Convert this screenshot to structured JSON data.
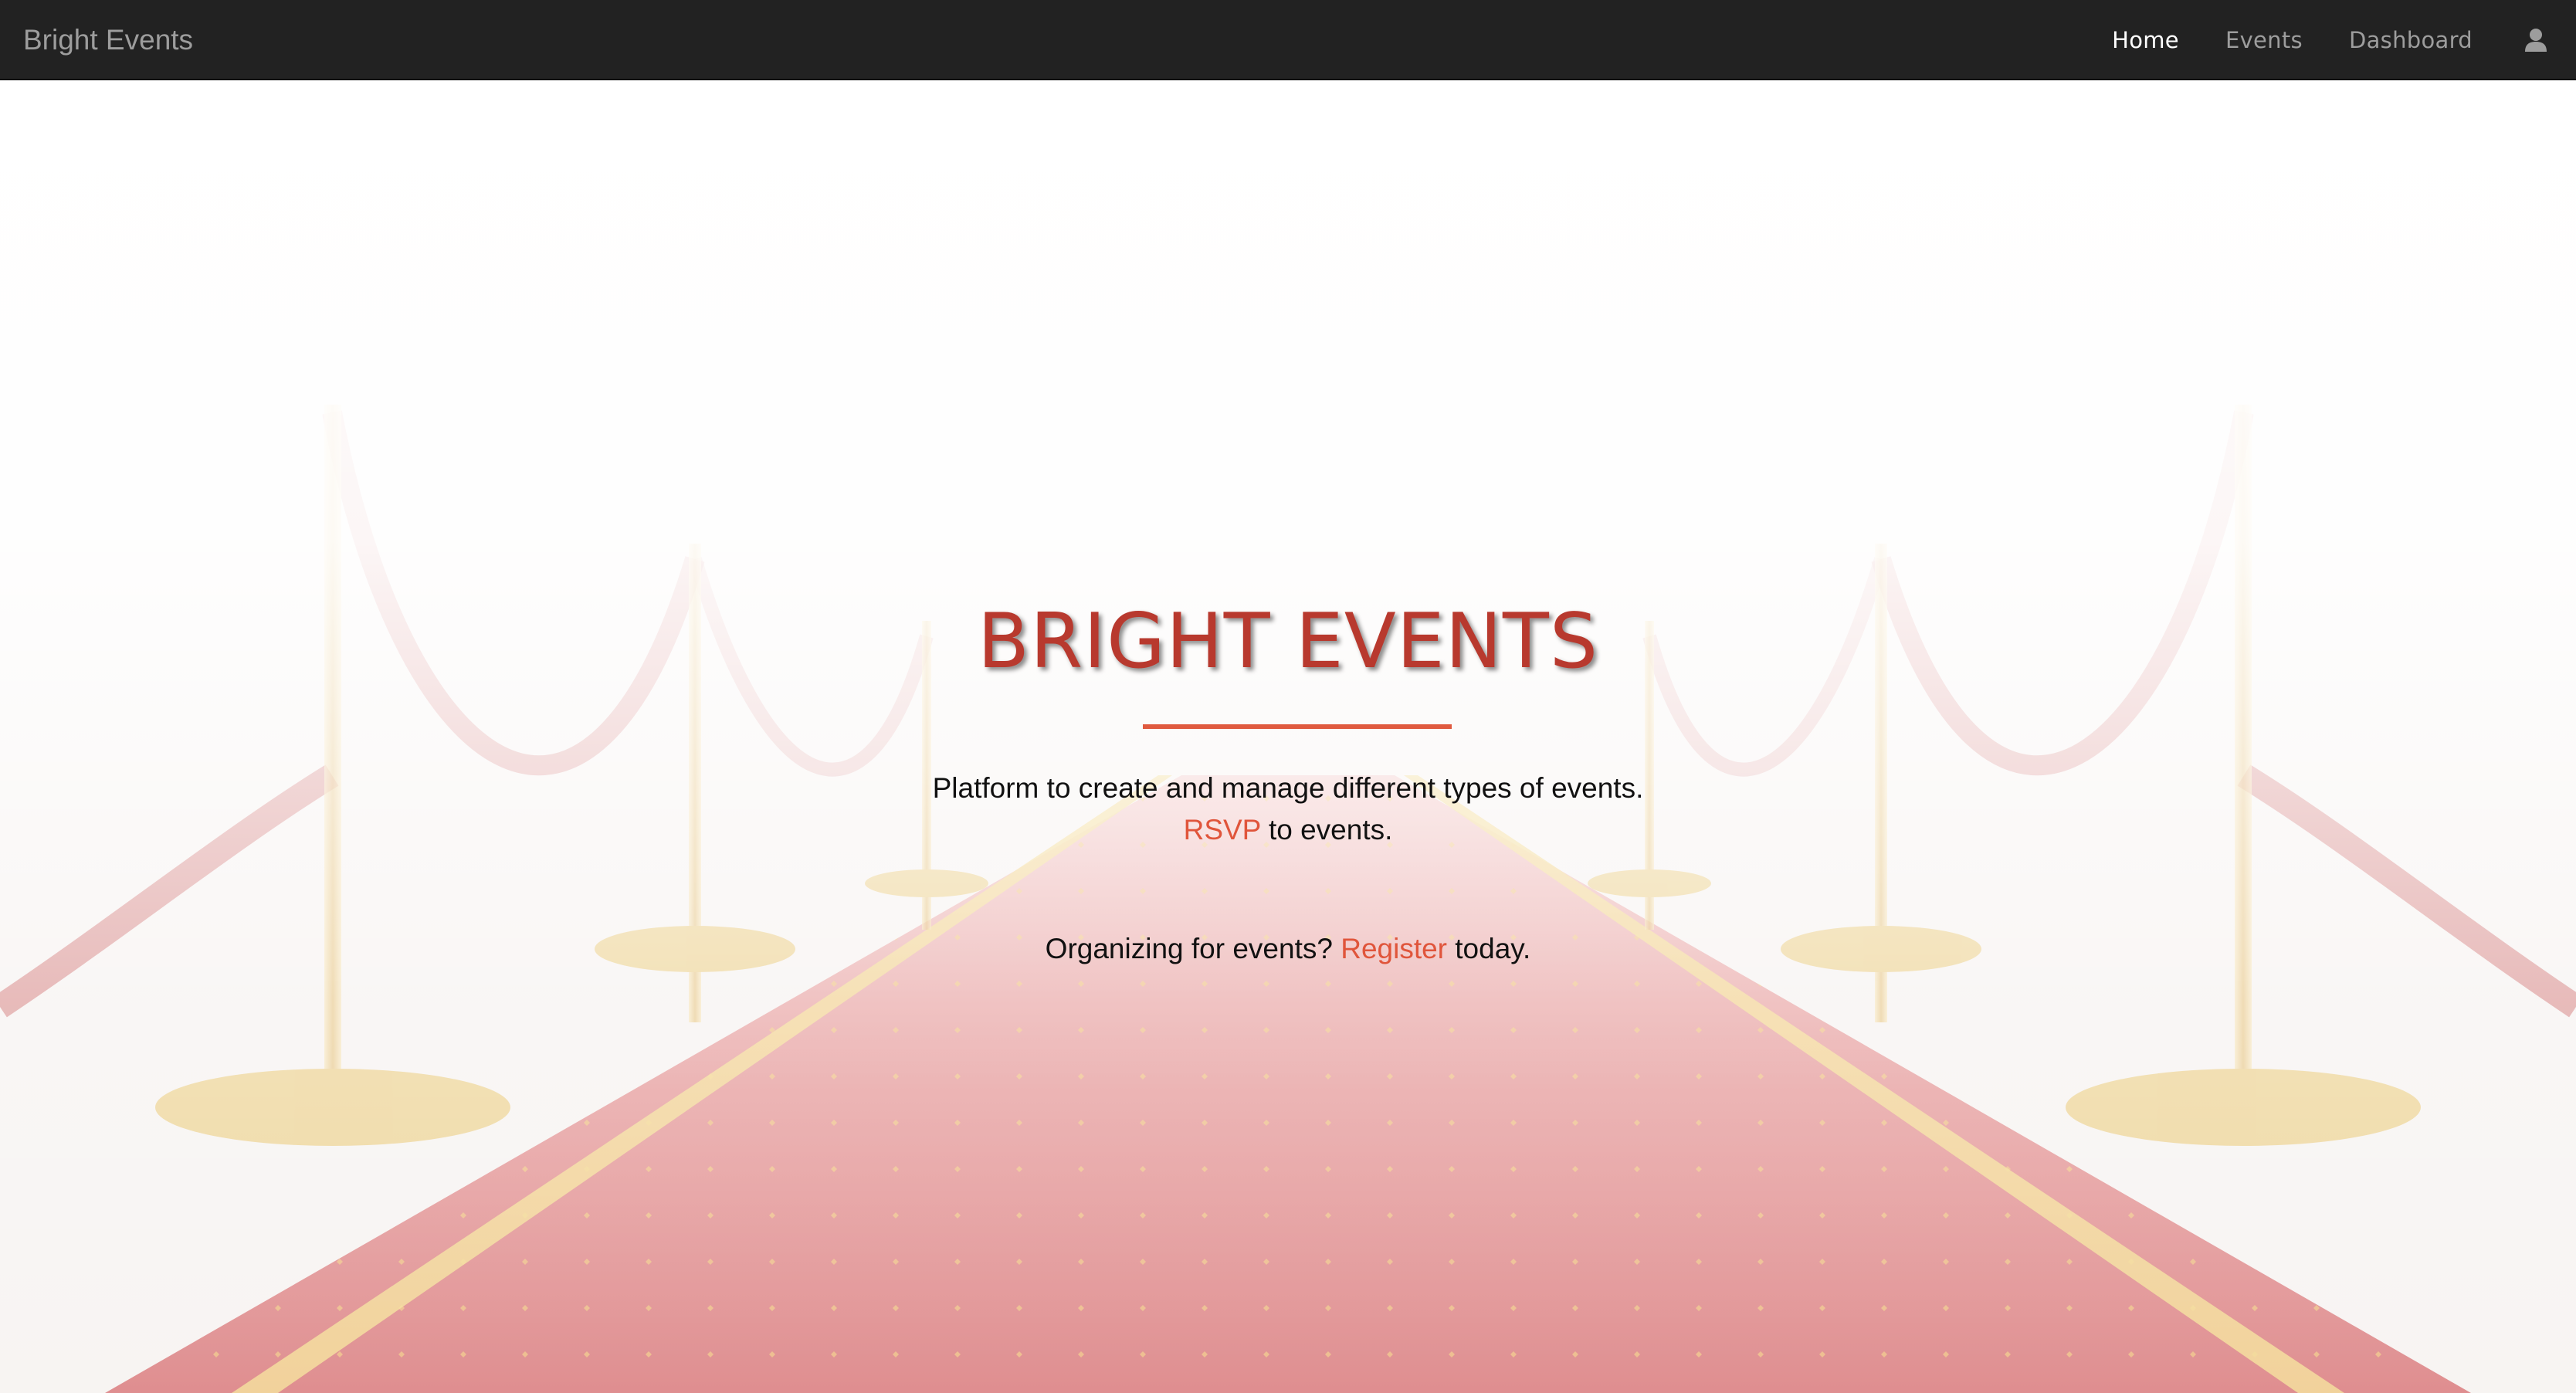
{
  "navbar": {
    "brand": "Bright Events",
    "links": [
      {
        "label": "Home",
        "active": true
      },
      {
        "label": "Events",
        "active": false
      },
      {
        "label": "Dashboard",
        "active": false
      }
    ],
    "user_icon": "user-icon"
  },
  "hero": {
    "title": "BRIGHT EVENTS",
    "tagline": "Platform to create and manage different types of events.",
    "rsvp_link": "RSVP",
    "rsvp_suffix": " to events.",
    "organizing_prefix": "Organizing for events? ",
    "register_link": "Register",
    "organizing_suffix": " today."
  },
  "colors": {
    "navbar_bg": "#222222",
    "title": "#b8392e",
    "accent": "#e0553b",
    "carpet": "#d9545a",
    "gold": "#e8c46a"
  }
}
